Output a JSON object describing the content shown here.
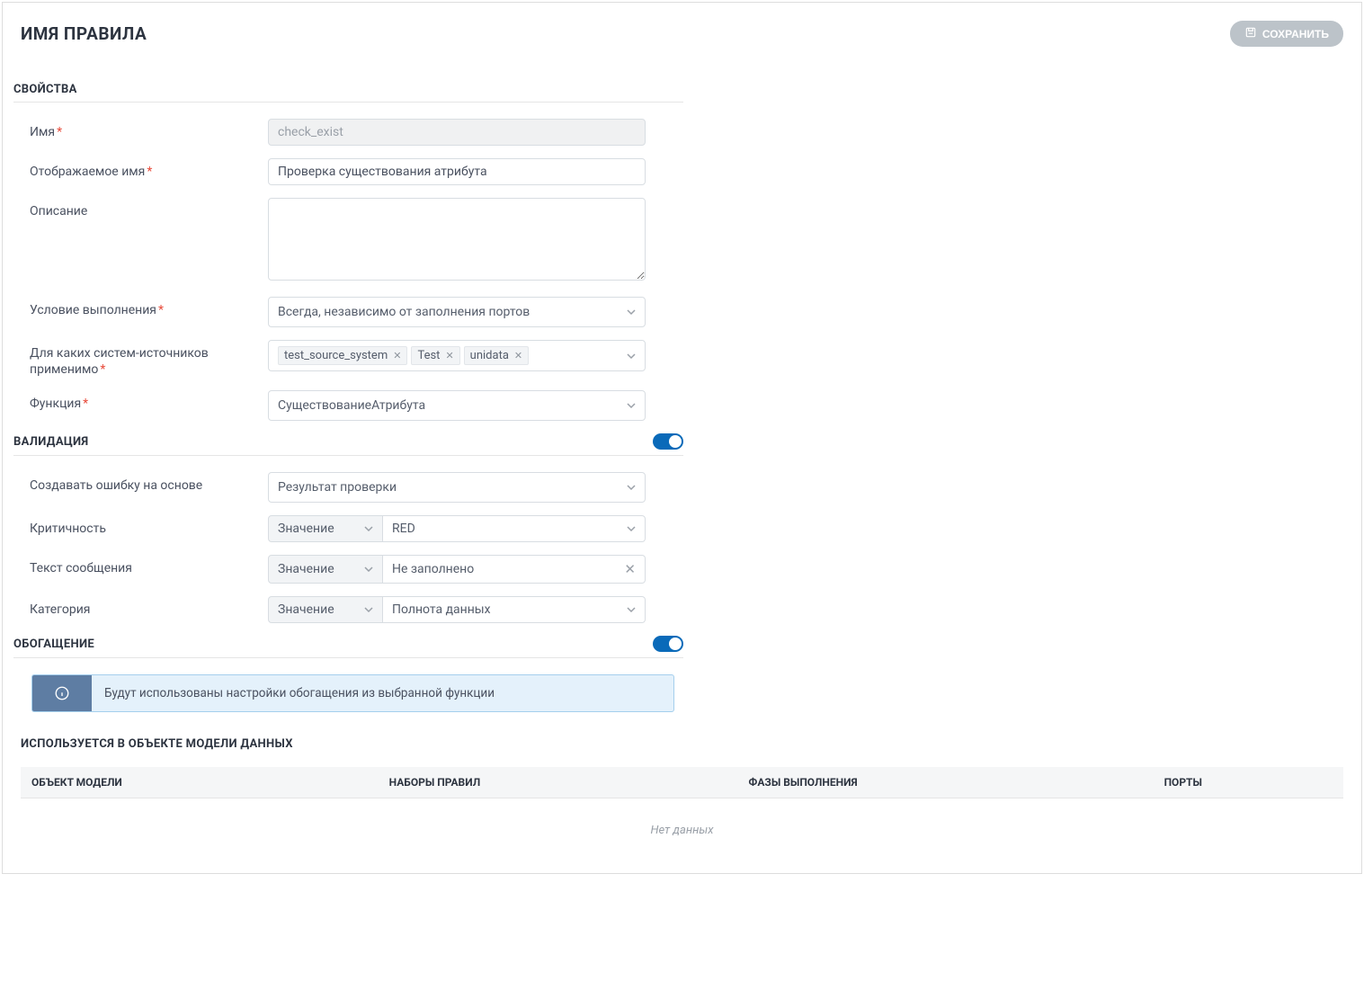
{
  "header": {
    "title": "ИМЯ ПРАВИЛА",
    "save_label": "СОХРАНИТЬ"
  },
  "properties": {
    "section_title": "СВОЙСТВА",
    "name_label": "Имя",
    "name_value": "check_exist",
    "display_name_label": "Отображаемое имя",
    "display_name_value": "Проверка существования атрибута",
    "description_label": "Описание",
    "description_value": "",
    "condition_label": "Условие выполнения",
    "condition_value": "Всегда, независимо от заполнения портов",
    "sources_label": "Для каких систем-источников применимо",
    "sources": [
      "test_source_system",
      "Test",
      "unidata"
    ],
    "function_label": "Функция",
    "function_value": "СуществованиеАтрибута"
  },
  "validation": {
    "section_title": "ВАЛИДАЦИЯ",
    "error_basis_label": "Создавать ошибку на основе",
    "error_basis_value": "Результат проверки",
    "criticality_label": "Критичность",
    "criticality_mode": "Значение",
    "criticality_value": "RED",
    "message_label": "Текст сообщения",
    "message_mode": "Значение",
    "message_value": "Не заполнено",
    "category_label": "Категория",
    "category_mode": "Значение",
    "category_value": "Полнота данных"
  },
  "enrichment": {
    "section_title": "ОБОГАЩЕНИЕ",
    "info_text": "Будут использованы настройки обогащения из выбранной функции"
  },
  "usage": {
    "section_title": "ИСПОЛЬЗУЕТСЯ В ОБЪЕКТЕ МОДЕЛИ ДАННЫХ",
    "columns": [
      "ОБЪЕКТ МОДЕЛИ",
      "НАБОРЫ ПРАВИЛ",
      "ФАЗЫ ВЫПОЛНЕНИЯ",
      "ПОРТЫ"
    ],
    "empty_text": "Нет данных"
  }
}
